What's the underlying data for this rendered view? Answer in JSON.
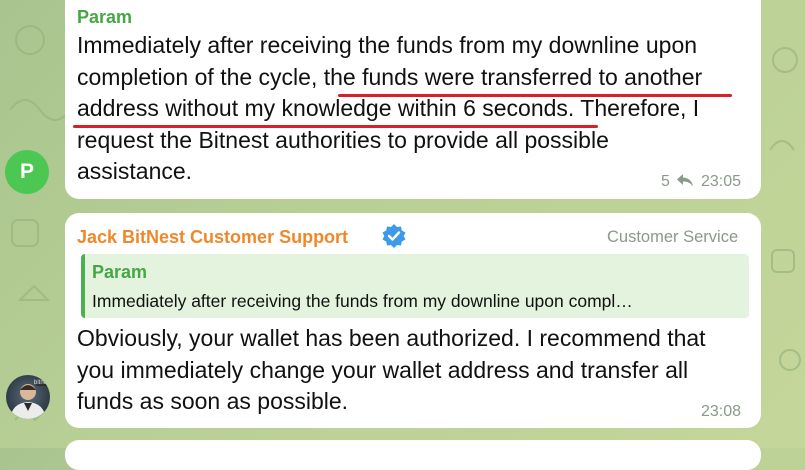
{
  "messages": [
    {
      "sender": "Param",
      "sender_color": "#45a843",
      "text": "Immediately after receiving the funds from my downline upon\ncompletion of the cycle, the funds were transferred to another\naddress without my knowledge within 6 seconds. Therefore, I\nrequest the Bitnest authorities to provide all possible\nassistance.",
      "reply_count": "5",
      "time": "23:05",
      "avatar_letter": "P"
    },
    {
      "sender": "Jack BitNest Customer Support",
      "sender_color": "#f0882a",
      "verified_icon": "verified-badge-icon",
      "role": "Customer Service",
      "reply": {
        "sender": "Param",
        "text": "Immediately after receiving the funds from my downline upon compl…"
      },
      "text": "Obviously, your wallet has been authorized. I recommend that\nyou immediately change your wallet address and transfer all\nfunds as soon as possible.",
      "time": "23:08",
      "avatar_label": "bitnes"
    }
  ],
  "colors": {
    "highlight_underline": "#d8202a",
    "meta_text": "#8a9a8a",
    "reply_accent": "#4caf50"
  }
}
